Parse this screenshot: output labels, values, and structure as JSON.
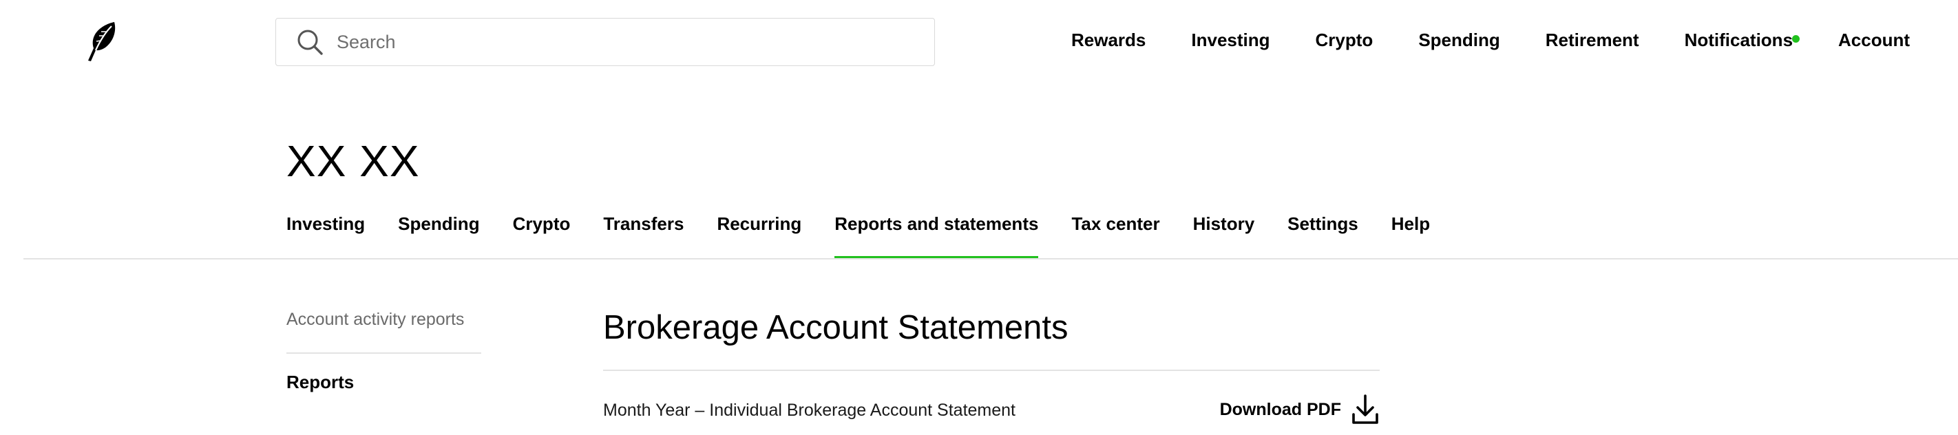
{
  "header": {
    "logo_icon": "feather-logo-icon",
    "search": {
      "placeholder": "Search",
      "value": ""
    },
    "nav": [
      {
        "label": "Rewards"
      },
      {
        "label": "Investing"
      },
      {
        "label": "Crypto"
      },
      {
        "label": "Spending"
      },
      {
        "label": "Retirement"
      },
      {
        "label": "Notifications",
        "has_dot": true
      },
      {
        "label": "Account"
      }
    ],
    "notification_dot_color": "#21c11e"
  },
  "account": {
    "name": "XX XX"
  },
  "tabs": [
    {
      "label": "Investing"
    },
    {
      "label": "Spending"
    },
    {
      "label": "Crypto"
    },
    {
      "label": "Transfers"
    },
    {
      "label": "Recurring"
    },
    {
      "label": "Reports and statements",
      "active": true
    },
    {
      "label": "Tax center"
    },
    {
      "label": "History"
    },
    {
      "label": "Settings"
    },
    {
      "label": "Help"
    }
  ],
  "accent_color": "#21c11e",
  "sidebar": {
    "link": "Account activity reports",
    "heading": "Reports"
  },
  "main": {
    "title": "Brokerage Account Statements",
    "statements": [
      {
        "name": "Month Year – Individual Brokerage Account Statement",
        "action_label": "Download PDF",
        "action_icon": "download-icon"
      }
    ]
  }
}
